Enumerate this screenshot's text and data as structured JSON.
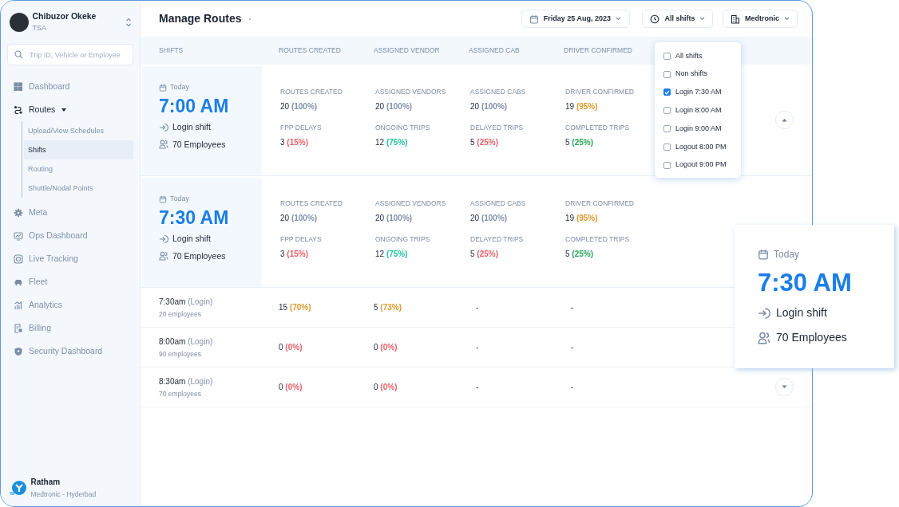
{
  "user": {
    "name": "Chibuzor Okeke",
    "role": "TSA"
  },
  "search": {
    "placeholder": "Trip ID, Vehicle or Employee"
  },
  "nav": [
    {
      "label": "Dashboard",
      "selected": false
    },
    {
      "label": "Routes",
      "selected": false,
      "expanded": true,
      "children": [
        {
          "label": "Upload/View Schedules",
          "selected": false
        },
        {
          "label": "Shifts",
          "selected": true
        },
        {
          "label": "Routing",
          "selected": false
        },
        {
          "label": "Shuttle/Nodal Points",
          "selected": false
        }
      ]
    },
    {
      "label": "Meta",
      "selected": false
    },
    {
      "label": "Ops Dashboard",
      "selected": false
    },
    {
      "label": "Live Tracking",
      "selected": false
    },
    {
      "label": "Fleet",
      "selected": false
    },
    {
      "label": "Analytics",
      "selected": false
    },
    {
      "label": "Billing",
      "selected": false
    },
    {
      "label": "Security Dashboard",
      "selected": false
    }
  ],
  "org": {
    "name": "Ratham",
    "location": "Medtronic - Hyderbad"
  },
  "header": {
    "title": "Manage Routes",
    "filters": [
      {
        "label": "Friday 25 Aug, 2023"
      },
      {
        "label": "All shifts"
      },
      {
        "label": "Medtronic"
      }
    ]
  },
  "columns": [
    "SHIFTS",
    "ROUTES CREATED",
    "ASSIGNED VENDOR",
    "ASSIGNED CAB",
    "DRIVER CONFIRMED"
  ],
  "shifts": [
    {
      "expanded": true,
      "has_toggle": true,
      "day": "Today",
      "time": "7:00 AM",
      "type": "Login shift",
      "employees": "70 Employees",
      "stats": [
        {
          "label": "ROUTES CREATED",
          "value": "20",
          "pct": "(100%)",
          "color": "#8392a8"
        },
        {
          "label": "ASSIGNED VENDORS",
          "value": "20",
          "pct": "(100%)",
          "color": "#8392a8"
        },
        {
          "label": "ASSIGNED CABS",
          "value": "20",
          "pct": "(100%)",
          "color": "#8392a8"
        },
        {
          "label": "DRIVER CONFIRMED",
          "value": "19",
          "pct": "(95%)",
          "color": "#dc9a2c"
        },
        {
          "label": "FPP DELAYS",
          "value": "3",
          "pct": "(15%)",
          "color": "#e5606a"
        },
        {
          "label": "ONGOING TRIPS",
          "value": "12",
          "pct": "(75%)",
          "color": "#22bfa0"
        },
        {
          "label": "DELAYED TRIPS",
          "value": "5",
          "pct": "(25%)",
          "color": "#e5606a"
        },
        {
          "label": "COMPLETED TRIPS",
          "value": "5",
          "pct": "(25%)",
          "color": "#27a556"
        }
      ]
    },
    {
      "expanded": true,
      "day": "Today",
      "time": "7:30 AM",
      "type": "Login shift",
      "employees": "70 Employees",
      "stats": [
        {
          "label": "ROUTES CREATED",
          "value": "20",
          "pct": "(100%)",
          "color": "#8392a8"
        },
        {
          "label": "ASSIGNED VENDORS",
          "value": "20",
          "pct": "(100%)",
          "color": "#8392a8"
        },
        {
          "label": "ASSIGNED CABS",
          "value": "20",
          "pct": "(100%)",
          "color": "#8392a8"
        },
        {
          "label": "DRIVER CONFIRMED",
          "value": "19",
          "pct": "(95%)",
          "color": "#dc9a2c"
        },
        {
          "label": "FPP DELAYS",
          "value": "3",
          "pct": "(15%)",
          "color": "#e5606a"
        },
        {
          "label": "ONGOING TRIPS",
          "value": "12",
          "pct": "(75%)",
          "color": "#22bfa0"
        },
        {
          "label": "DELAYED TRIPS",
          "value": "5",
          "pct": "(25%)",
          "color": "#e5606a"
        },
        {
          "label": "COMPLETED TRIPS",
          "value": "5",
          "pct": "(25%)",
          "color": "#27a556"
        }
      ]
    },
    {
      "expanded": false,
      "time": "7:30am",
      "type": "(Login)",
      "employees": "20 employees",
      "cells": [
        {
          "value": "15",
          "pct": "(70%)",
          "color": "#dc9a2c"
        },
        {
          "value": "5",
          "pct": "(73%)",
          "color": "#dc9a2c"
        },
        {
          "value": "-"
        },
        {
          "value": "-"
        }
      ]
    },
    {
      "expanded": false,
      "time": "8:00am",
      "type": "(Login)",
      "employees": "90 employees",
      "cells": [
        {
          "value": "0",
          "pct": "(0%)",
          "color": "#e5606a"
        },
        {
          "value": "0",
          "pct": "(0%)",
          "color": "#e5606a"
        },
        {
          "value": "-"
        },
        {
          "value": "-"
        }
      ]
    },
    {
      "expanded": false,
      "has_toggle": true,
      "time": "8:30am",
      "type": "(Login)",
      "employees": "70 employees",
      "cells": [
        {
          "value": "0",
          "pct": "(0%)",
          "color": "#e5606a"
        },
        {
          "value": "0",
          "pct": "(0%)",
          "color": "#e5606a"
        },
        {
          "value": "-"
        },
        {
          "value": "-"
        }
      ]
    }
  ],
  "dropdown": [
    {
      "label": "All shifts",
      "checked": false
    },
    {
      "label": "Non shifts",
      "checked": false
    },
    {
      "label": "Login 7:30 AM",
      "checked": true
    },
    {
      "label": "Login 8:00 AM",
      "checked": false
    },
    {
      "label": "Login 9:00 AM",
      "checked": false
    },
    {
      "label": "Logout 8:00 PM",
      "checked": false
    },
    {
      "label": "Logout 9:00 PM",
      "checked": false
    }
  ],
  "zoom_card": {
    "day": "Today",
    "time": "7:30 AM",
    "type": "Login shift",
    "employees": "70 Employees"
  }
}
